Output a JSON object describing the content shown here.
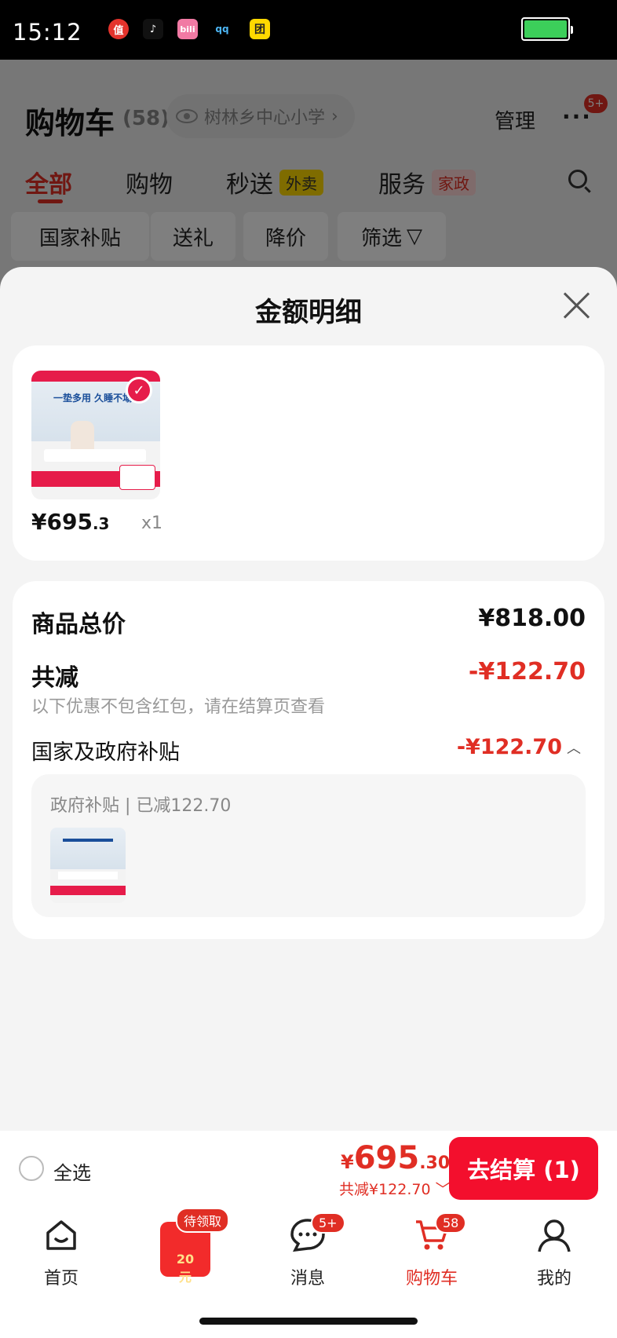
{
  "status_bar": {
    "time": "15:12",
    "app_icons": [
      "值",
      "♪",
      "bili",
      "qq",
      "团"
    ]
  },
  "background_page": {
    "title": "购物车",
    "count": "(58)",
    "location": "树林乡中心小学",
    "manage": "管理",
    "more_badge": "5+",
    "tabs": [
      {
        "label": "全部"
      },
      {
        "label": "购物"
      },
      {
        "label": "秒送",
        "tag": "外卖"
      },
      {
        "label": "服务",
        "tag": "家政"
      }
    ],
    "chips": [
      "国家补贴",
      "送礼",
      "降价",
      "筛选"
    ]
  },
  "sheet": {
    "title": "金额明细",
    "product": {
      "thumb_text": "一垫多用 久睡不塌",
      "price_main": "¥695",
      "price_dec": ".3",
      "qty": "x1"
    },
    "rows": {
      "total_label": "商品总价",
      "total_value": "¥818.00",
      "discount_label": "共减",
      "discount_value": "-¥122.70",
      "note": "以下优惠不包含红包，请在结算页查看",
      "gov_label": "国家及政府补贴",
      "gov_value": "-¥122.70"
    },
    "gov_detail": {
      "title": "政府补贴 | 已减122.70"
    }
  },
  "checkout_bar": {
    "select_all": "全选",
    "currency": "¥",
    "price_int": "695",
    "price_dec": ".30",
    "saved": "共减¥122.70",
    "checkout": "去结算 (1)"
  },
  "nav": {
    "items": [
      {
        "label": "首页"
      },
      {
        "label": "",
        "badge": "待领取",
        "coupon": "20元"
      },
      {
        "label": "消息",
        "badge": "5+"
      },
      {
        "label": "购物车",
        "badge": "58"
      },
      {
        "label": "我的"
      }
    ]
  },
  "colors": {
    "accent": "#e02e24",
    "checkout": "#f30f2d"
  }
}
